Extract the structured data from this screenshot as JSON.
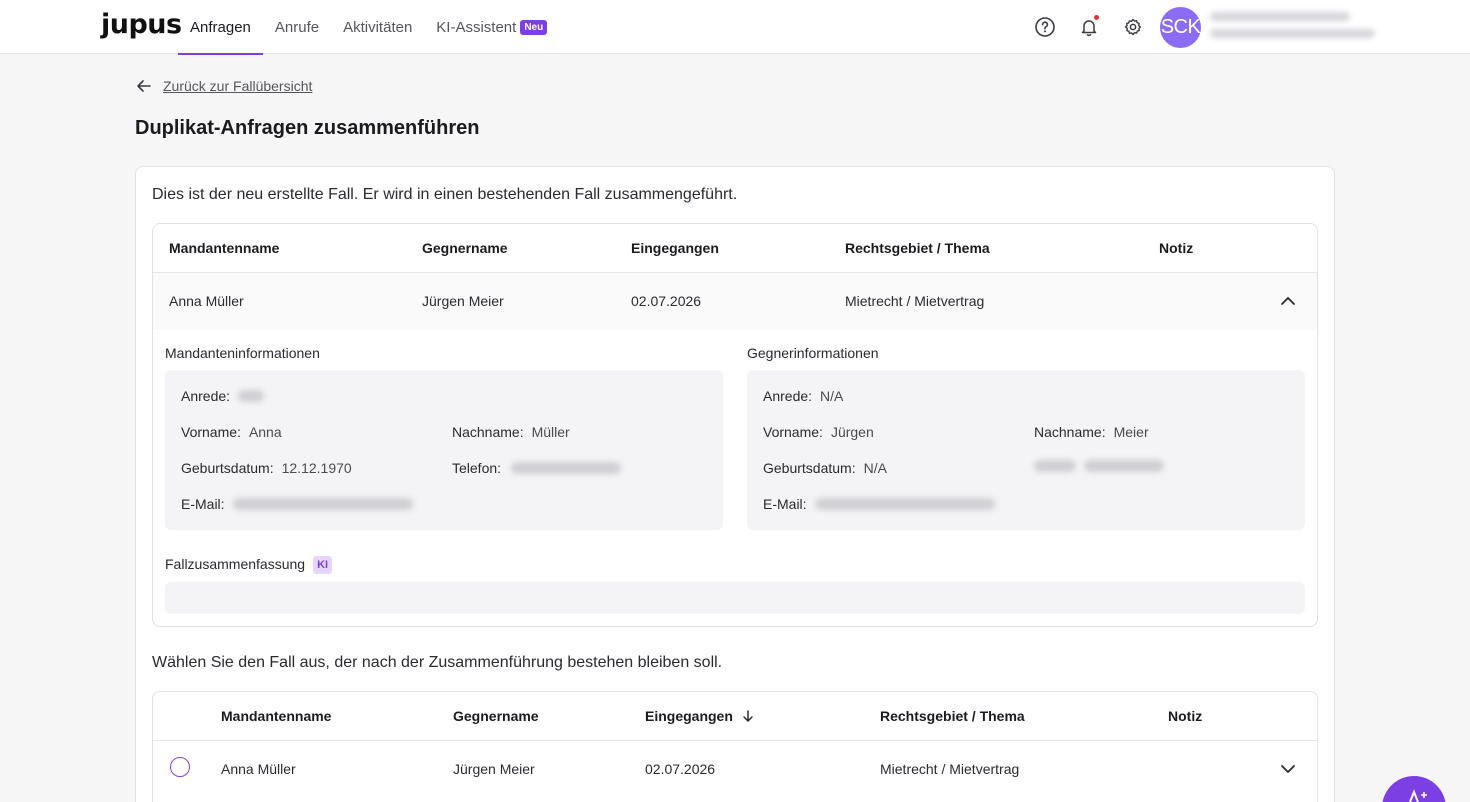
{
  "brand": {
    "logo": "jupus",
    "accent": "#7b3fe4"
  },
  "nav": {
    "items": [
      {
        "label": "Anfragen",
        "active": true
      },
      {
        "label": "Anrufe"
      },
      {
        "label": "Aktivitäten"
      },
      {
        "label": "KI-Assistent",
        "badge": "Neu"
      }
    ]
  },
  "header": {
    "icons": [
      "help-icon",
      "bell-icon",
      "settings-icon"
    ],
    "avatar_initials": "SCK"
  },
  "back_link": "Zurück zur Fallübersicht",
  "page_title": "Duplikat-Anfragen zusammenführen",
  "new_case": {
    "intro": "Dies ist der neu erstellte Fall. Er wird in einen bestehenden Fall zusammengeführt.",
    "columns": [
      "Mandantenname",
      "Gegnername",
      "Eingegangen",
      "Rechtsgebiet / Thema",
      "Notiz"
    ],
    "row": {
      "client": "Anna Müller",
      "opponent": "Jürgen Meier",
      "received": "02.07.2026",
      "topic": "Mietrecht / Mietvertrag",
      "note": ""
    },
    "client_info": {
      "title": "Mandanteninformationen",
      "anrede_label": "Anrede:",
      "vorname_label": "Vorname:",
      "vorname": "Anna",
      "nachname_label": "Nachname:",
      "nachname": "Müller",
      "geburtsdatum_label": "Geburtsdatum:",
      "geburtsdatum": "12.12.1970",
      "telefon_label": "Telefon:",
      "email_label": "E-Mail:"
    },
    "opponent_info": {
      "title": "Gegnerinformationen",
      "anrede_label": "Anrede:",
      "anrede": "N/A",
      "vorname_label": "Vorname:",
      "vorname": "Jürgen",
      "nachname_label": "Nachname:",
      "nachname": "Meier",
      "geburtsdatum_label": "Geburtsdatum:",
      "geburtsdatum": "N/A",
      "email_label": "E-Mail:"
    },
    "summary_label": "Fallzusammenfassung",
    "summary_badge": "KI"
  },
  "select_case": {
    "intro": "Wählen Sie den Fall aus, der nach der Zusammenführung bestehen bleiben soll.",
    "columns": [
      "Mandantenname",
      "Gegnername",
      "Eingegangen",
      "Rechtsgebiet / Thema",
      "Notiz"
    ],
    "sort_column": "Eingegangen",
    "rows": [
      {
        "client": "Anna Müller",
        "opponent": "Jürgen Meier",
        "received": "02.07.2026",
        "topic": "Mietrecht / Mietvertrag",
        "note": ""
      }
    ]
  }
}
